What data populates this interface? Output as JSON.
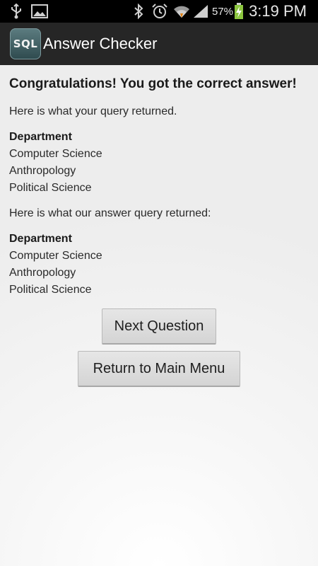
{
  "status_bar": {
    "battery_percent": "57%",
    "time": "3:19 PM",
    "icons": [
      "usb-icon",
      "image-icon",
      "bluetooth-icon",
      "alarm-icon",
      "wifi-icon",
      "signal-icon",
      "battery-charging-icon"
    ]
  },
  "action_bar": {
    "logo_text": "SQL",
    "title": "Answer Checker"
  },
  "result": {
    "headline": "Congratulations! You got the correct answer!",
    "your_query_label": "Here is what your query returned.",
    "your_table": {
      "header": "Department",
      "rows": [
        "Computer Science",
        "Anthropology",
        "Political Science"
      ]
    },
    "answer_query_label": "Here is what our answer query returned:",
    "answer_table": {
      "header": "Department",
      "rows": [
        "Computer Science",
        "Anthropology",
        "Political Science"
      ]
    }
  },
  "buttons": {
    "next_question": "Next Question",
    "return_main_menu": "Return to Main Menu"
  }
}
